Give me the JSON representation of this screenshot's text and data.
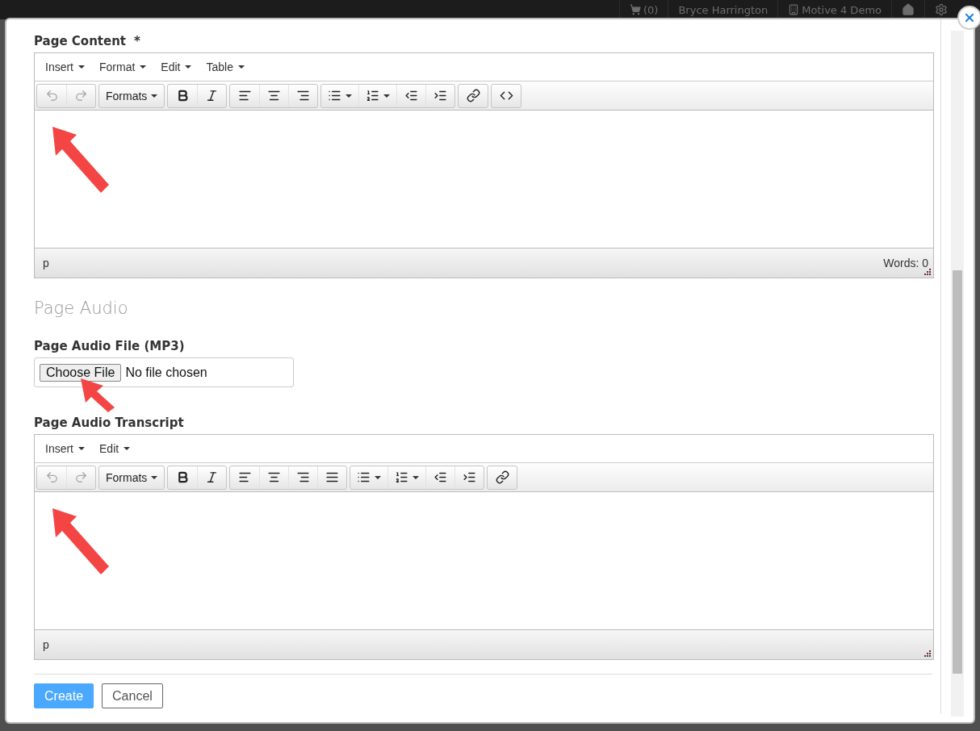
{
  "top_bar": {
    "cart_count": "(0)",
    "user": "Bryce Harrington",
    "account": "Motive 4 Demo"
  },
  "form": [
    {
      "kind": "editor",
      "label": "Page Content",
      "required_mark": "*",
      "menus": [
        "Insert",
        "Format",
        "Edit",
        "Table"
      ],
      "toolbar": [
        [
          {
            "kind": "undo",
            "disabled": true
          },
          {
            "kind": "redo",
            "disabled": true
          }
        ],
        [
          {
            "kind": "formats",
            "label": "Formats",
            "disabled": false
          }
        ],
        [
          {
            "kind": "bold",
            "disabled": false
          },
          {
            "kind": "italic",
            "disabled": false
          }
        ],
        [
          {
            "kind": "align-left",
            "disabled": false
          },
          {
            "kind": "align-center",
            "disabled": false
          },
          {
            "kind": "align-right",
            "disabled": false
          }
        ],
        [
          {
            "kind": "bullet-list",
            "disabled": false
          },
          {
            "kind": "numbered-list",
            "disabled": false
          },
          {
            "kind": "outdent",
            "disabled": false
          },
          {
            "kind": "indent",
            "disabled": false
          }
        ],
        [
          {
            "kind": "link",
            "disabled": false
          }
        ],
        [
          {
            "kind": "code",
            "disabled": false
          }
        ]
      ],
      "path": "p",
      "word_count": "Words: 0"
    },
    {
      "kind": "heading",
      "text": "Page Audio"
    },
    {
      "kind": "file",
      "label": "Page Audio File (MP3)",
      "button": "Choose File",
      "status": "No file chosen"
    },
    {
      "kind": "editor",
      "label": "Page Audio Transcript",
      "menus": [
        "Insert",
        "Edit"
      ],
      "toolbar": [
        [
          {
            "kind": "undo",
            "disabled": true
          },
          {
            "kind": "redo",
            "disabled": true
          }
        ],
        [
          {
            "kind": "formats",
            "label": "Formats",
            "disabled": false
          }
        ],
        [
          {
            "kind": "bold",
            "disabled": false
          },
          {
            "kind": "italic",
            "disabled": false
          }
        ],
        [
          {
            "kind": "align-left",
            "disabled": false
          },
          {
            "kind": "align-center",
            "disabled": false
          },
          {
            "kind": "align-right",
            "disabled": false
          },
          {
            "kind": "align-justify",
            "disabled": false
          }
        ],
        [
          {
            "kind": "bullet-list",
            "disabled": false
          },
          {
            "kind": "numbered-list",
            "disabled": false
          },
          {
            "kind": "outdent",
            "disabled": false
          },
          {
            "kind": "indent",
            "disabled": false
          }
        ],
        [
          {
            "kind": "link",
            "disabled": false
          }
        ]
      ],
      "path": "p"
    }
  ],
  "actions": [
    {
      "label": "Create",
      "primary": true
    },
    {
      "label": "Cancel",
      "primary": false
    }
  ]
}
